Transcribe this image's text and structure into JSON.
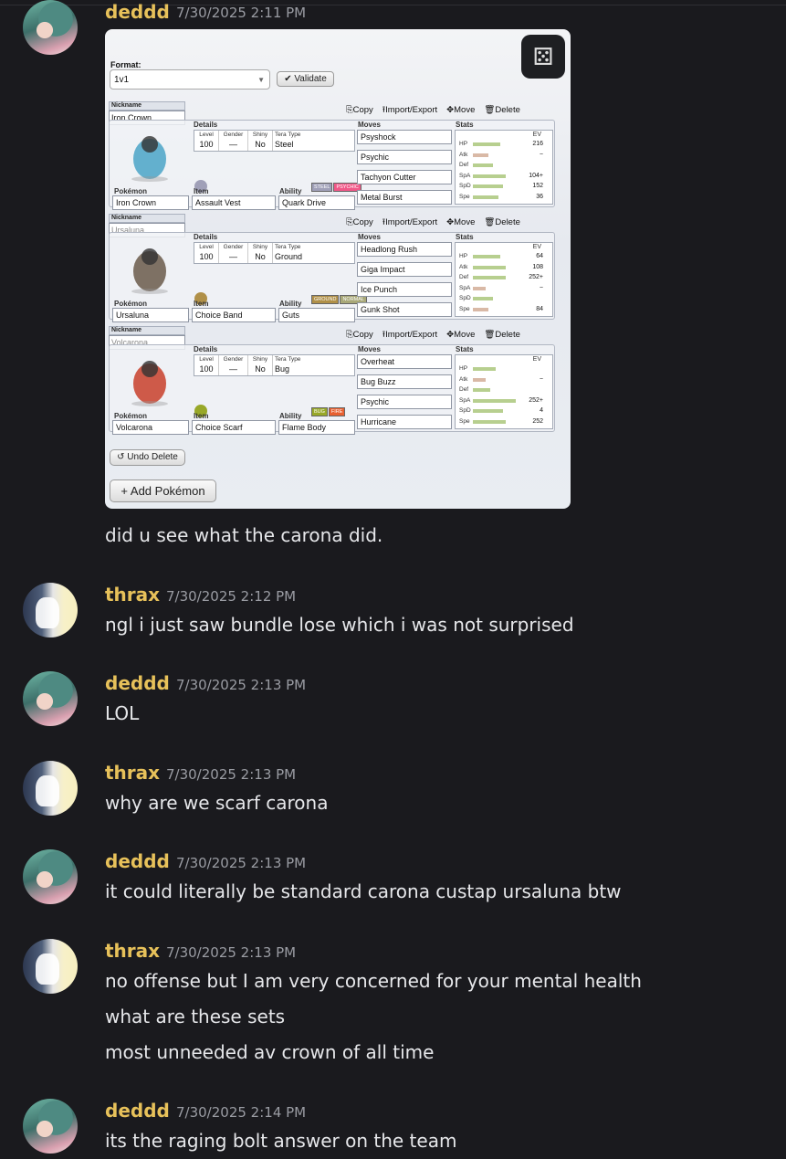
{
  "messages": [
    {
      "user": "deddd",
      "time": "7/30/2025 2:11 PM",
      "lines": [
        "did u see what the carona did."
      ]
    },
    {
      "user": "thrax",
      "time": "7/30/2025 2:12 PM",
      "lines": [
        "ngl i just saw bundle lose which i was not surprised"
      ]
    },
    {
      "user": "deddd",
      "time": "7/30/2025 2:13 PM",
      "lines": [
        "LOL"
      ]
    },
    {
      "user": "thrax",
      "time": "7/30/2025 2:13 PM",
      "lines": [
        "why are we scarf carona"
      ]
    },
    {
      "user": "deddd",
      "time": "7/30/2025 2:13 PM",
      "lines": [
        "it could literally be standard carona custap ursaluna btw"
      ]
    },
    {
      "user": "thrax",
      "time": "7/30/2025 2:13 PM",
      "lines": [
        "no offense but I am very concerned for your mental health",
        "what are these sets",
        "most unneeded av crown of all time"
      ]
    },
    {
      "user": "deddd",
      "time": "7/30/2025 2:14 PM",
      "lines": [
        "its the raging bolt answer on the team"
      ]
    }
  ],
  "teambuilder": {
    "dice_icon": "dice-icon",
    "format_label": "Format:",
    "format_value": "1v1",
    "validate_label": "✔ Validate",
    "action_labels": {
      "copy": "Copy",
      "import_export": "Import/Export",
      "move": "Move",
      "delete": "Delete"
    },
    "labels": {
      "nickname": "Nickname",
      "details": "Details",
      "moves": "Moves",
      "stats": "Stats",
      "pokemon": "Pokémon",
      "item": "Item",
      "ability": "Ability",
      "level": "Level",
      "gender": "Gender",
      "shiny": "Shiny",
      "tera": "Tera Type",
      "ev": "EV"
    },
    "stat_names": [
      "HP",
      "Atk",
      "Def",
      "SpA",
      "SpD",
      "Spe"
    ],
    "sets": [
      {
        "nickname": "Iron Crown",
        "nickname_placeholder": false,
        "level": "100",
        "gender": "—",
        "shiny": "No",
        "tera": "Steel",
        "types": [
          "STEEL",
          "PSYCHIC"
        ],
        "type_colors": [
          "#a0a0b8",
          "#f05888"
        ],
        "pokemon": "Iron Crown",
        "item": "Assault Vest",
        "ability": "Quark Drive",
        "moves": [
          "Psyshock",
          "Psychic",
          "Tachyon Cutter",
          "Metal Burst"
        ],
        "stat_bars": [
          0.55,
          0.3,
          0.4,
          0.65,
          0.6,
          0.5
        ],
        "evs": [
          "216",
          "−",
          "",
          "104+",
          "152",
          "36"
        ],
        "sprite_color": "#4aa4c7"
      },
      {
        "nickname": "Ursaluna",
        "nickname_placeholder": true,
        "level": "100",
        "gender": "—",
        "shiny": "No",
        "tera": "Ground",
        "types": [
          "GROUND",
          "NORMAL"
        ],
        "type_colors": [
          "#b09048",
          "#a8a878"
        ],
        "pokemon": "Ursaluna",
        "item": "Choice Band",
        "ability": "Guts",
        "moves": [
          "Headlong Rush",
          "Giga Impact",
          "Ice Punch",
          "Gunk Shot"
        ],
        "stat_bars": [
          0.55,
          0.65,
          0.65,
          0.25,
          0.4,
          0.3
        ],
        "evs": [
          "64",
          "108",
          "252+",
          "−",
          "",
          "84"
        ],
        "sprite_color": "#6a5a4a"
      },
      {
        "nickname": "Volcarona",
        "nickname_placeholder": true,
        "level": "100",
        "gender": "—",
        "shiny": "No",
        "tera": "Bug",
        "types": [
          "BUG",
          "FIRE"
        ],
        "type_colors": [
          "#98a828",
          "#e86030"
        ],
        "pokemon": "Volcarona",
        "item": "Choice Scarf",
        "ability": "Flame Body",
        "moves": [
          "Overheat",
          "Bug Buzz",
          "Psychic",
          "Hurricane"
        ],
        "stat_bars": [
          0.45,
          0.25,
          0.35,
          0.85,
          0.6,
          0.65
        ],
        "evs": [
          "",
          "−",
          "",
          "252+",
          "4",
          "252"
        ],
        "sprite_color": "#c8402a"
      }
    ],
    "undo_label": "↺ Undo Delete",
    "add_label": "+ Add Pokémon"
  }
}
